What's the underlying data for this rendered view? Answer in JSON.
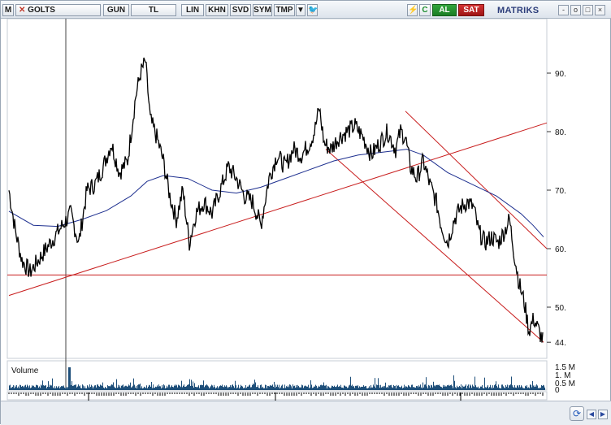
{
  "toolbar": {
    "app_icon": "M",
    "symbol": "GOLTS",
    "period": "GUN",
    "currency": "TL",
    "scale_lin": "LIN",
    "khn": "KHN",
    "svd": "SVD",
    "sym": "SYM",
    "tmp": "TMP",
    "dropdown_icon": "chevron-down-icon",
    "twitter_icon": "twitter-icon",
    "bolt_icon": "lightning-icon",
    "refresh_small": "C",
    "buy_label": "AL",
    "sell_label": "SAT",
    "brand": "MATRIKS",
    "win_minimize": "-",
    "win_restore": "□",
    "win_close": "×",
    "extra_labels": [
      "_",
      "o"
    ]
  },
  "chart_data": {
    "type": "line",
    "title": "",
    "price_axis": {
      "ticks": [
        "90.",
        "80.",
        "70.",
        "60.",
        "50.",
        "44."
      ],
      "tick_values": [
        90,
        80,
        70,
        60,
        50,
        44
      ]
    },
    "time_axis": {
      "labels": [
        "16",
        "17",
        "18"
      ]
    },
    "volume_panel": {
      "label": "Volume",
      "ticks": [
        "1.5 M",
        "1. M",
        "0.5 M",
        "0"
      ]
    },
    "series_colors": {
      "price": "#000000",
      "moving_average": "#1d2f8f",
      "trendlines": "#c81d1d",
      "volume": "#1e4f7a"
    }
  },
  "bottombar": {
    "nav_left": "◀",
    "nav_right": "▶",
    "refresh_icon": "refresh-icon"
  }
}
